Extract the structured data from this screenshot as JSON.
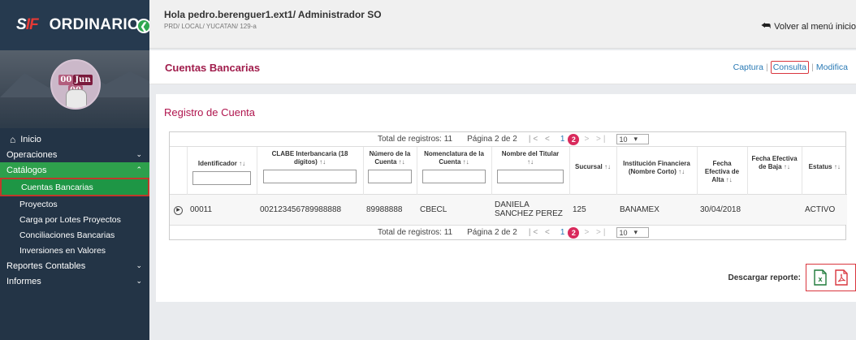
{
  "app": {
    "name": "ORDINARIO",
    "logo_text_s": "S",
    "logo_text_if": "IF"
  },
  "profile": {
    "day": "00",
    "month": "Jun",
    "year": "00"
  },
  "sidebar": {
    "items": [
      {
        "label": "Inicio"
      },
      {
        "label": "Operaciones"
      },
      {
        "label": "Catálogos"
      },
      {
        "label": "Cuentas Bancarias"
      },
      {
        "label": "Proyectos"
      },
      {
        "label": "Carga por Lotes Proyectos"
      },
      {
        "label": "Conciliaciones Bancarias"
      },
      {
        "label": "Inversiones en Valores"
      },
      {
        "label": "Reportes Contables"
      },
      {
        "label": "Informes"
      }
    ]
  },
  "header": {
    "greeting": "Hola pedro.berenguer1.ext1/ Administrador SO",
    "path": "PRD/ LOCAL/ YUCATAN/ 129-a",
    "back": "Volver al menú inicio"
  },
  "page": {
    "title": "Cuentas Bancarias",
    "actions": {
      "captura": "Captura",
      "consulta": "Consulta",
      "modifica": "Modifica"
    }
  },
  "section": {
    "title": "Registro de Cuenta"
  },
  "pager": {
    "total": "Total de registros: 11",
    "page": "Página 2 de 2",
    "first_prev": "|< <",
    "p1": "1",
    "p2": "2",
    "next_last": "> >|",
    "size": "10"
  },
  "table": {
    "columns": [
      "Identificador",
      "CLABE Interbancaria (18 dígitos)",
      "Número de la Cuenta",
      "Nomenclatura de la Cuenta",
      "Nombre del Titular",
      "Sucursal",
      "Institución Financiera (Nombre Corto)",
      "Fecha Efectiva de Alta",
      "Fecha Efectiva de Baja",
      "Estatus"
    ],
    "rows": [
      {
        "id": "00011",
        "clabe": "002123456789988888",
        "numero": "89988888",
        "nomenclatura": "CBECL",
        "titular": "DANIELA SANCHEZ PEREZ",
        "sucursal": "125",
        "institucion": "BANAMEX",
        "alta": "30/04/2018",
        "baja": "",
        "estatus": "ACTIVO"
      }
    ]
  },
  "download": {
    "label": "Descargar reporte:"
  },
  "colors": {
    "accent": "#a01c4b",
    "sidebar": "#233446",
    "active": "#1e9645",
    "highlight": "#d9363e"
  }
}
